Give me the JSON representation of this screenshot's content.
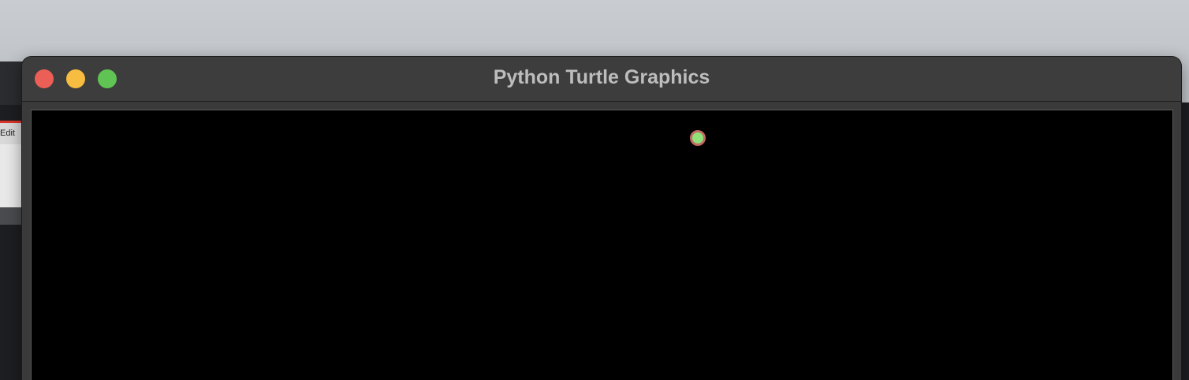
{
  "background_app": {
    "menu_label": "Edit"
  },
  "window": {
    "title": "Python Turtle Graphics",
    "controls": {
      "close": "close-button",
      "minimize": "minimize-button",
      "zoom": "zoom-button"
    }
  },
  "canvas": {
    "background_color": "#000000",
    "turtle": {
      "fill_color": "#8fe27a",
      "outline_color": "#c26a63",
      "shape": "circle"
    }
  },
  "colors": {
    "close": "#ec5f57",
    "minimize": "#f6bd40",
    "zoom": "#5fc454"
  }
}
